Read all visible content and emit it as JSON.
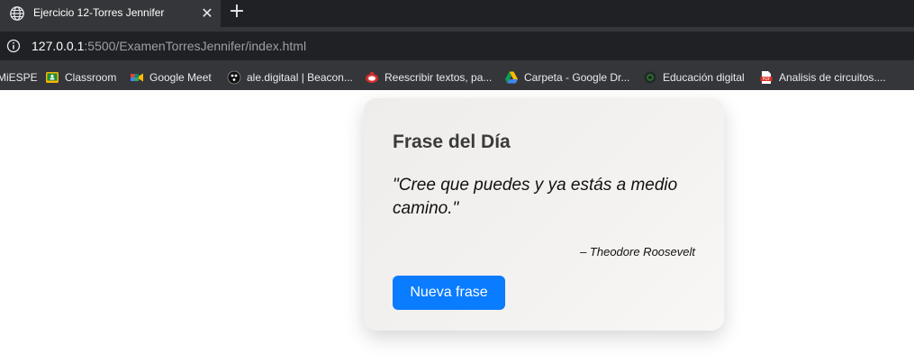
{
  "browser": {
    "tab": {
      "title": "Ejercicio 12-Torres Jennifer",
      "close_glyph": "✕",
      "favicon": "globe-icon"
    },
    "new_tab_glyph": "+",
    "address": {
      "host": "127.0.0.1",
      "rest": ":5500/ExamenTorresJennifer/index.html",
      "icon": "info-icon"
    },
    "bookmarks": [
      {
        "label": "MiESPE",
        "icon": "none"
      },
      {
        "label": "Classroom",
        "icon": "classroom-icon"
      },
      {
        "label": "Google Meet",
        "icon": "google-meet-icon"
      },
      {
        "label": "ale.digitaal | Beacon...",
        "icon": "beacon-icon"
      },
      {
        "label": "Reescribir textos, pa...",
        "icon": "rewrite-icon"
      },
      {
        "label": "Carpeta - Google Dr...",
        "icon": "google-drive-icon"
      },
      {
        "label": "Educación digital",
        "icon": "education-icon"
      },
      {
        "label": "Analisis de circuitos....",
        "icon": "pdf-icon"
      }
    ]
  },
  "card": {
    "title": "Frase del Día",
    "quote": "\"Cree que puedes y ya estás a medio camino.\"",
    "author": "– Theodore Roosevelt",
    "button_label": "Nueva frase"
  },
  "colors": {
    "tab_bar": "#202124",
    "toolbar": "#35363a",
    "button": "#0a7cff",
    "card_bg": "#f3f1ef"
  }
}
